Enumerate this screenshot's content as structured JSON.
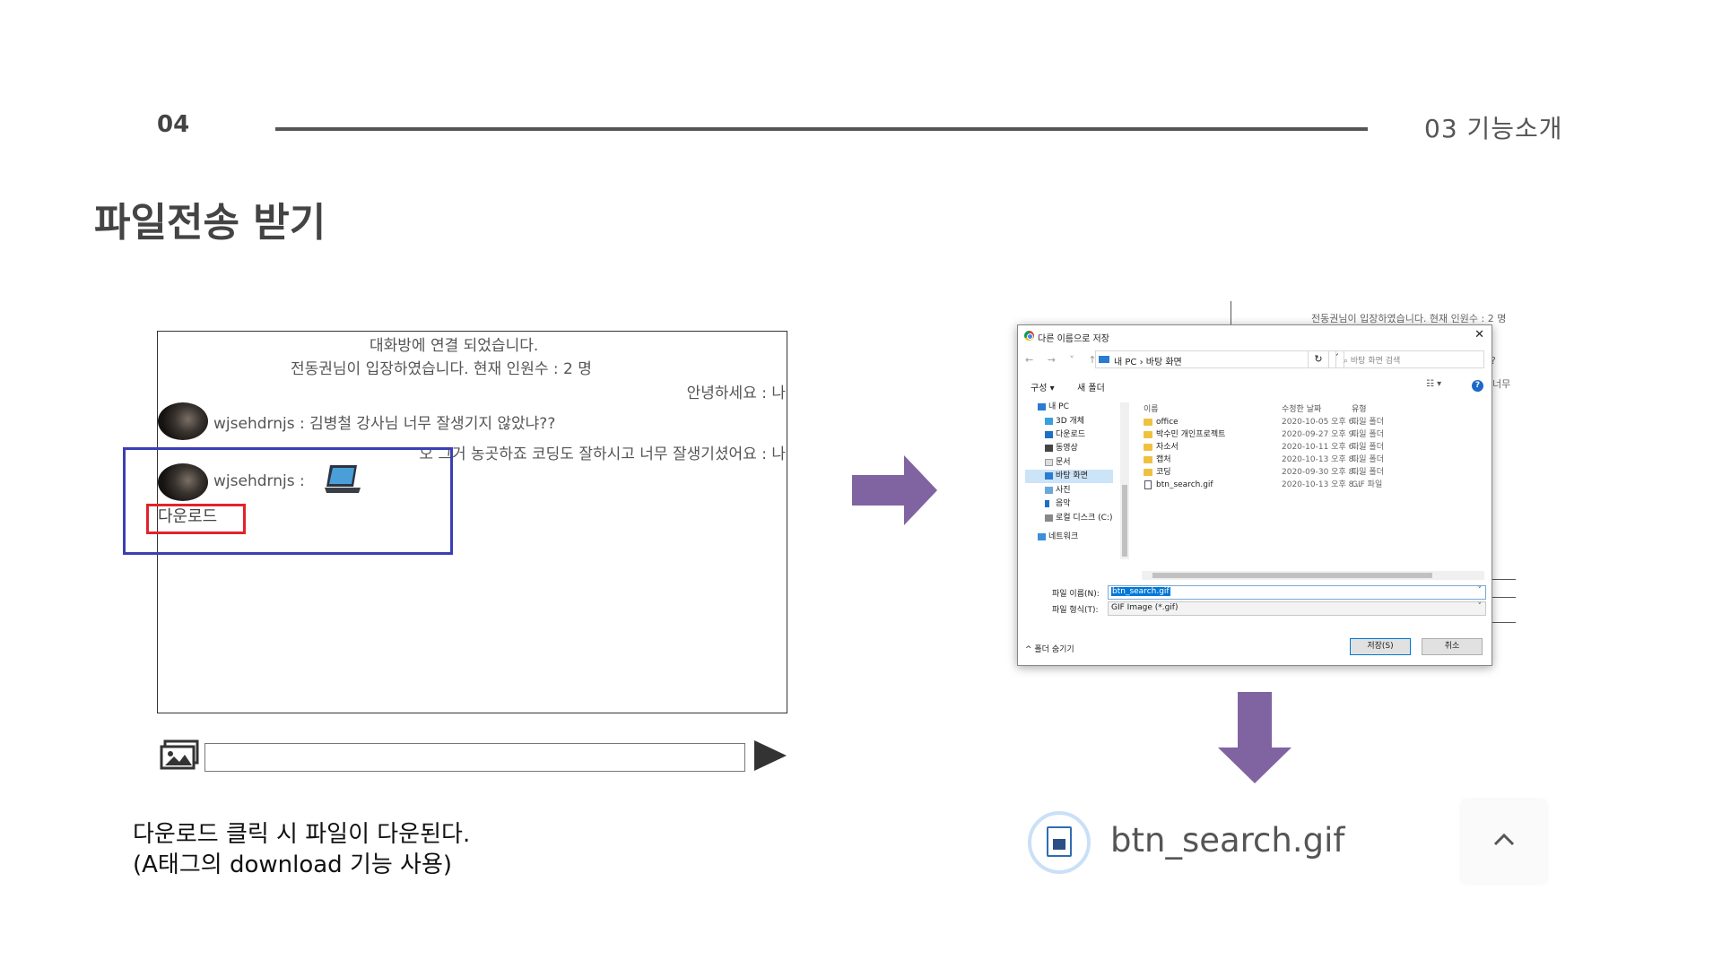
{
  "header": {
    "page_number": "04",
    "section": "03  기능소개",
    "title": "파일전송 받기"
  },
  "chat": {
    "system_line_1": "대화방에 연결 되었습니다.",
    "system_line_2": "전동권님이 입장하였습니다. 현재 인원수 : 2 명",
    "my_message_1": "안녕하세요 : 나",
    "msg_user_1": "wjsehdrnjs : 김병철 강사님 너무 잘생기지 않았냐??",
    "my_message_2": "오 그거 농곳하죠 코딩도 잘하시고 너무 잘생기셨어요 : 나",
    "msg_user_2": "wjsehdrnjs :",
    "download_link": "다운로드"
  },
  "caption": {
    "line1": "다운로드 클릭 시 파일이 다운된다.",
    "line2": "(A태그의 download 기능 사용)"
  },
  "save_dialog": {
    "bg_text_1": "전동권님이 입장하였습니다. 현재 인원수 : 2 명",
    "bg_text_2": "?",
    "bg_text_3": "너무",
    "title": "다른 이름으로 저장",
    "close": "✕",
    "nav_buttons": "← → ˅ ↑",
    "path": "내 PC  ›  바탕 화면",
    "refresh": "↻",
    "search_placeholder": "바탕 화면 검색",
    "organize": "구성 ▾",
    "new_folder": "새 폴더",
    "view": "☷ ▾",
    "help": "?",
    "nav_items": [
      {
        "label": "내 PC"
      },
      {
        "label": "3D 개체"
      },
      {
        "label": "다운로드"
      },
      {
        "label": "동영상"
      },
      {
        "label": "문서"
      },
      {
        "label": "바탕 화면"
      },
      {
        "label": "사진"
      },
      {
        "label": "음악"
      },
      {
        "label": "로컬 디스크 (C:)"
      },
      {
        "label": "네트워크"
      }
    ],
    "columns": {
      "name": "이름",
      "date": "수정한 날짜",
      "type": "유형"
    },
    "files": [
      {
        "name": "office",
        "date": "2020-10-05 오후 6...",
        "type": "파일 폴더"
      },
      {
        "name": "박수민 개인프로젝트",
        "date": "2020-09-27 오후 9...",
        "type": "파일 폴더"
      },
      {
        "name": "자소서",
        "date": "2020-10-11 오후 6...",
        "type": "파일 폴더"
      },
      {
        "name": "캡처",
        "date": "2020-10-13 오후 8...",
        "type": "파일 폴더"
      },
      {
        "name": "코딩",
        "date": "2020-09-30 오후 8...",
        "type": "파일 폴더"
      },
      {
        "name": "btn_search.gif",
        "date": "2020-10-13 오후 8...",
        "type": "GIF 파일"
      }
    ],
    "filename_label": "파일 이름(N):",
    "filename_value": "btn_search.gif",
    "filetype_label": "파일 형식(T):",
    "filetype_value": "GIF Image (*.gif)",
    "hide_folders": "^ 폴더 숨기기",
    "save_button": "저장(S)",
    "cancel_button": "취소"
  },
  "download_bar": {
    "file_name": "btn_search.gif"
  },
  "colors": {
    "arrow": "#8064a2",
    "highlight_blue": "#3b3fb5",
    "highlight_red": "#e0232b",
    "header_text": "#444444"
  }
}
